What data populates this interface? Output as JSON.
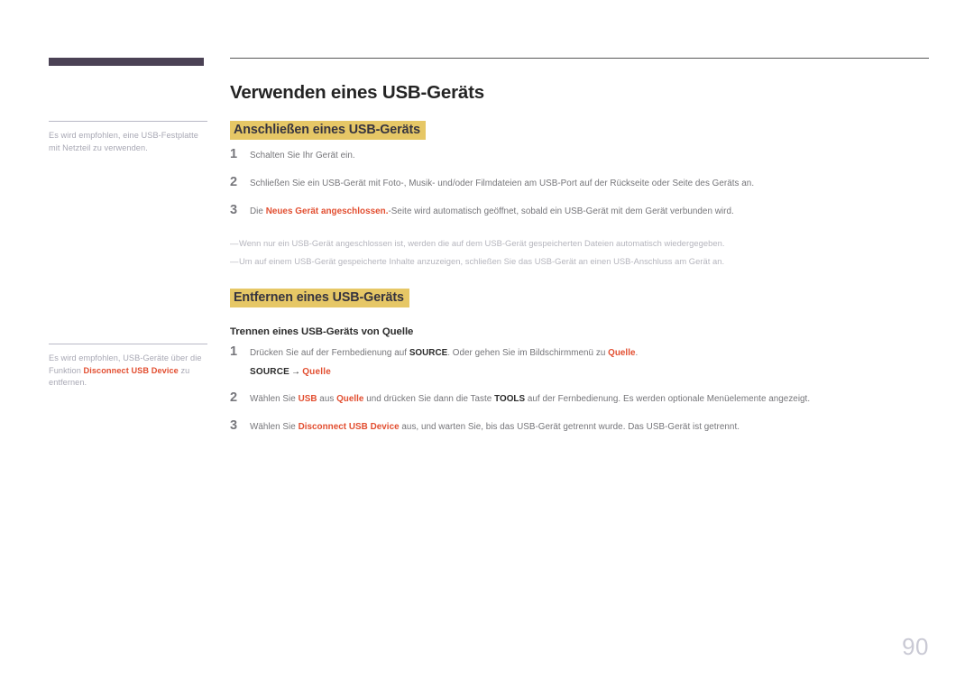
{
  "document": {
    "page_number": "90",
    "title": "Verwenden eines USB-Geräts"
  },
  "colors": {
    "sidebar_bar": "#4b4255",
    "heading_highlight": "#e6c766",
    "accent_red": "#e24e30",
    "body_gray": "#757579",
    "note_gray": "#b5b5bd"
  },
  "sidebar": {
    "notes": [
      {
        "id": "note-usb-festplatte",
        "parts": [
          {
            "text": "Es wird empfohlen, eine USB-Festplatte mit Netzteil zu verwenden.",
            "style": "normal"
          }
        ]
      },
      {
        "id": "note-disconnect",
        "parts": [
          {
            "text": "Es wird empfohlen, USB-Geräte über die Funktion ",
            "style": "normal"
          },
          {
            "text": "Disconnect USB Device",
            "style": "red-bold"
          },
          {
            "text": " zu entfernen.",
            "style": "normal"
          }
        ]
      }
    ]
  },
  "main": {
    "title": "Verwenden eines USB-Geräts",
    "sections": [
      {
        "id": "anschliessen",
        "heading": "Anschließen eines USB-Geräts",
        "steps": [
          {
            "number": "1",
            "parts": [
              {
                "text": "Schalten Sie Ihr Gerät ein.",
                "style": "normal"
              }
            ]
          },
          {
            "number": "2",
            "parts": [
              {
                "text": "Schließen Sie ein USB-Gerät mit Foto-, Musik- und/oder Filmdateien am USB-Port auf der Rückseite oder Seite des Geräts an.",
                "style": "normal"
              }
            ]
          },
          {
            "number": "3",
            "parts": [
              {
                "text": "Die ",
                "style": "normal"
              },
              {
                "text": "Neues Gerät angeschlossen.",
                "style": "red-bold"
              },
              {
                "text": "-Seite wird automatisch geöffnet, sobald ein USB-Gerät mit dem Gerät verbunden wird.",
                "style": "normal"
              }
            ]
          }
        ],
        "notes": [
          {
            "dash": "―",
            "text": "Wenn nur ein USB-Gerät angeschlossen ist, werden die auf dem USB-Gerät gespeicherten Dateien automatisch wiedergegeben."
          },
          {
            "dash": "―",
            "text": "Um auf einem USB-Gerät gespeicherte Inhalte anzuzeigen, schließen Sie das USB-Gerät an einen USB-Anschluss am Gerät an."
          }
        ]
      },
      {
        "id": "entfernen",
        "heading": "Entfernen eines USB-Geräts",
        "subheading": "Trennen eines USB-Geräts von Quelle",
        "steps": [
          {
            "number": "1",
            "parts": [
              {
                "text": "Drücken Sie auf der Fernbedienung auf ",
                "style": "normal"
              },
              {
                "text": "SOURCE",
                "style": "dark-bold"
              },
              {
                "text": ". Oder gehen Sie im Bildschirmmenü zu ",
                "style": "normal"
              },
              {
                "text": "Quelle",
                "style": "red-bold"
              },
              {
                "text": ".",
                "style": "normal"
              }
            ]
          },
          {
            "number": "2",
            "parts": [
              {
                "text": "Wählen Sie ",
                "style": "normal"
              },
              {
                "text": "USB",
                "style": "red-bold"
              },
              {
                "text": " aus ",
                "style": "normal"
              },
              {
                "text": "Quelle",
                "style": "red-bold"
              },
              {
                "text": " und drücken Sie dann die Taste ",
                "style": "normal"
              },
              {
                "text": "TOOLS",
                "style": "dark-bold"
              },
              {
                "text": " auf der Fernbedienung. Es werden optionale Menüelemente angezeigt.",
                "style": "normal"
              }
            ]
          },
          {
            "number": "3",
            "parts": [
              {
                "text": "Wählen Sie ",
                "style": "normal"
              },
              {
                "text": "Disconnect USB Device",
                "style": "red-bold"
              },
              {
                "text": " aus, und warten Sie, bis das USB-Gerät getrennt wurde. Das USB-Gerät ist getrennt.",
                "style": "normal"
              }
            ]
          }
        ],
        "path": {
          "source": "SOURCE",
          "arrow": "→",
          "target": "Quelle"
        }
      }
    ]
  }
}
